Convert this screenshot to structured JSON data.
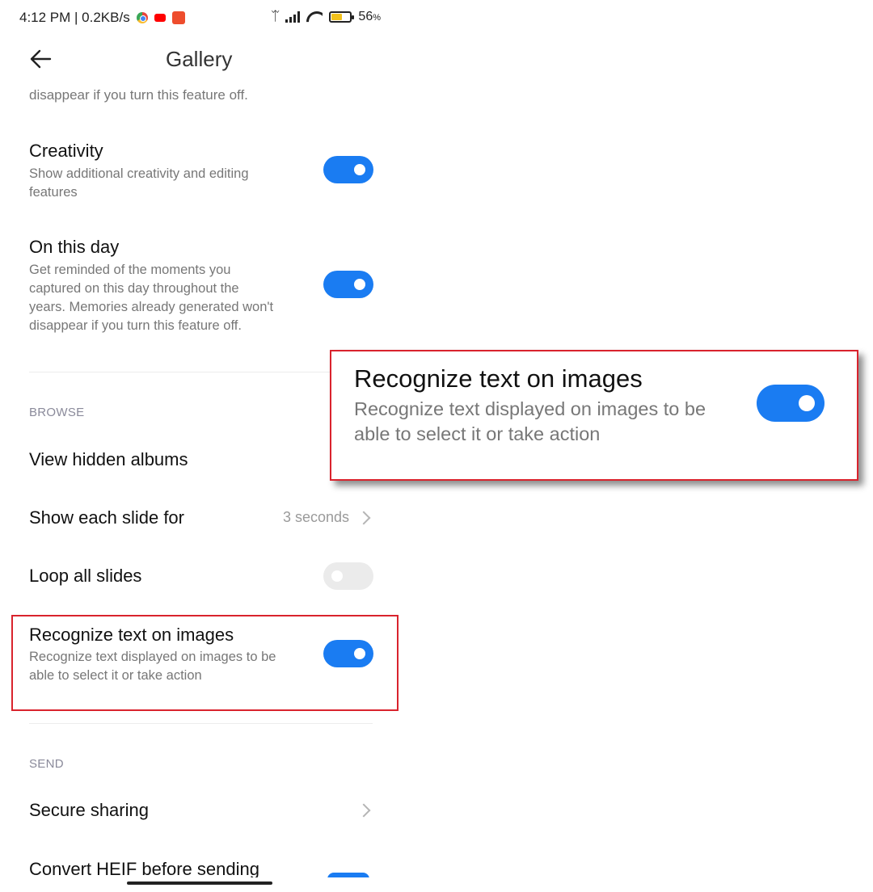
{
  "status_bar": {
    "time_speed": "4:12 PM | 0.2KB/s",
    "battery_percent": "56",
    "battery_unit": "%",
    "battery_level": 0.56,
    "app_icons": [
      "chrome-icon",
      "youtube-icon",
      "shopee-icon"
    ]
  },
  "header": {
    "title": "Gallery",
    "back_icon": "arrow-left-icon"
  },
  "truncated_description": "disappear if you turn this feature off.",
  "settings": [
    {
      "title": "Creativity",
      "description_lines": [
        "Show additional creativity and editing",
        "features"
      ],
      "toggle": true
    },
    {
      "title": "On this day",
      "description_lines": [
        "Get reminded of the moments you",
        "captured on this day throughout the",
        "years. Memories already generated won't",
        "disappear if you turn this feature off."
      ],
      "toggle": true
    }
  ],
  "browse": {
    "header": "BROWSE",
    "view_hidden_albums": "View hidden albums",
    "show_each_slide_for": {
      "title": "Show each slide for",
      "value": "3 seconds"
    },
    "loop_all_slides": {
      "title": "Loop all slides",
      "toggle": false
    },
    "recognize_text": {
      "title": "Recognize text on images",
      "description_lines": [
        "Recognize text displayed on images to be",
        "able to select it or take action"
      ],
      "toggle": true
    }
  },
  "send": {
    "header": "SEND",
    "secure_sharing": "Secure sharing",
    "convert_heif": "Convert HEIF before sending"
  },
  "callout": {
    "title": "Recognize text on images",
    "description_lines": [
      "Recognize text displayed on images to be",
      "able to select it or take action"
    ],
    "toggle": true
  },
  "colors": {
    "accent": "#1a7cf2",
    "highlight": "#d9232d",
    "toggle_off": "#ebebeb"
  }
}
